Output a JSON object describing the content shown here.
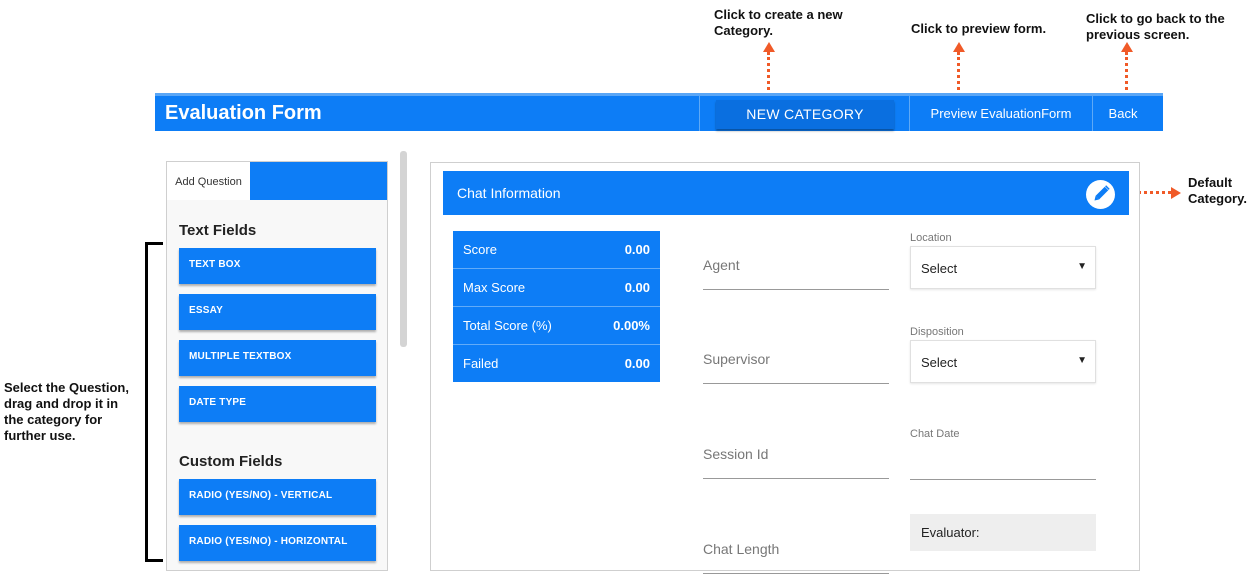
{
  "annotations": {
    "new_category": "Click to create a new Category.",
    "preview": "Click to preview form.",
    "back": "Click to go back to the previous screen.",
    "default_category": "Default Category.",
    "drag_drop": "Select the Question, drag and drop it in the category for further use."
  },
  "header": {
    "title": "Evaluation Form",
    "new_category_label": "NEW CATEGORY",
    "preview_label": "Preview EvaluationForm",
    "back_label": "Back"
  },
  "left_panel": {
    "tab_label": "Add Question",
    "text_fields_title": "Text Fields",
    "text_fields": [
      "TEXT BOX",
      "ESSAY",
      "MULTIPLE TEXTBOX",
      "DATE TYPE"
    ],
    "custom_fields_title": "Custom Fields",
    "custom_fields": [
      "RADIO (YES/NO) - VERTICAL",
      "RADIO (YES/NO) - HORIZONTAL"
    ]
  },
  "category": {
    "title": "Chat Information",
    "scores": [
      {
        "label": "Score",
        "value": "0.00"
      },
      {
        "label": "Max Score",
        "value": "0.00"
      },
      {
        "label": "Total Score (%)",
        "value": "0.00%"
      },
      {
        "label": "Failed",
        "value": "0.00"
      }
    ],
    "fields": {
      "agent": "Agent",
      "supervisor": "Supervisor",
      "session_id": "Session Id",
      "chat_length": "Chat Length"
    },
    "location": {
      "label": "Location",
      "value": "Select"
    },
    "disposition": {
      "label": "Disposition",
      "value": "Select"
    },
    "chat_date_label": "Chat Date",
    "evaluator_label": "Evaluator:"
  },
  "colors": {
    "primary": "#0d7df6",
    "annotation_arrow": "#f05a28"
  }
}
